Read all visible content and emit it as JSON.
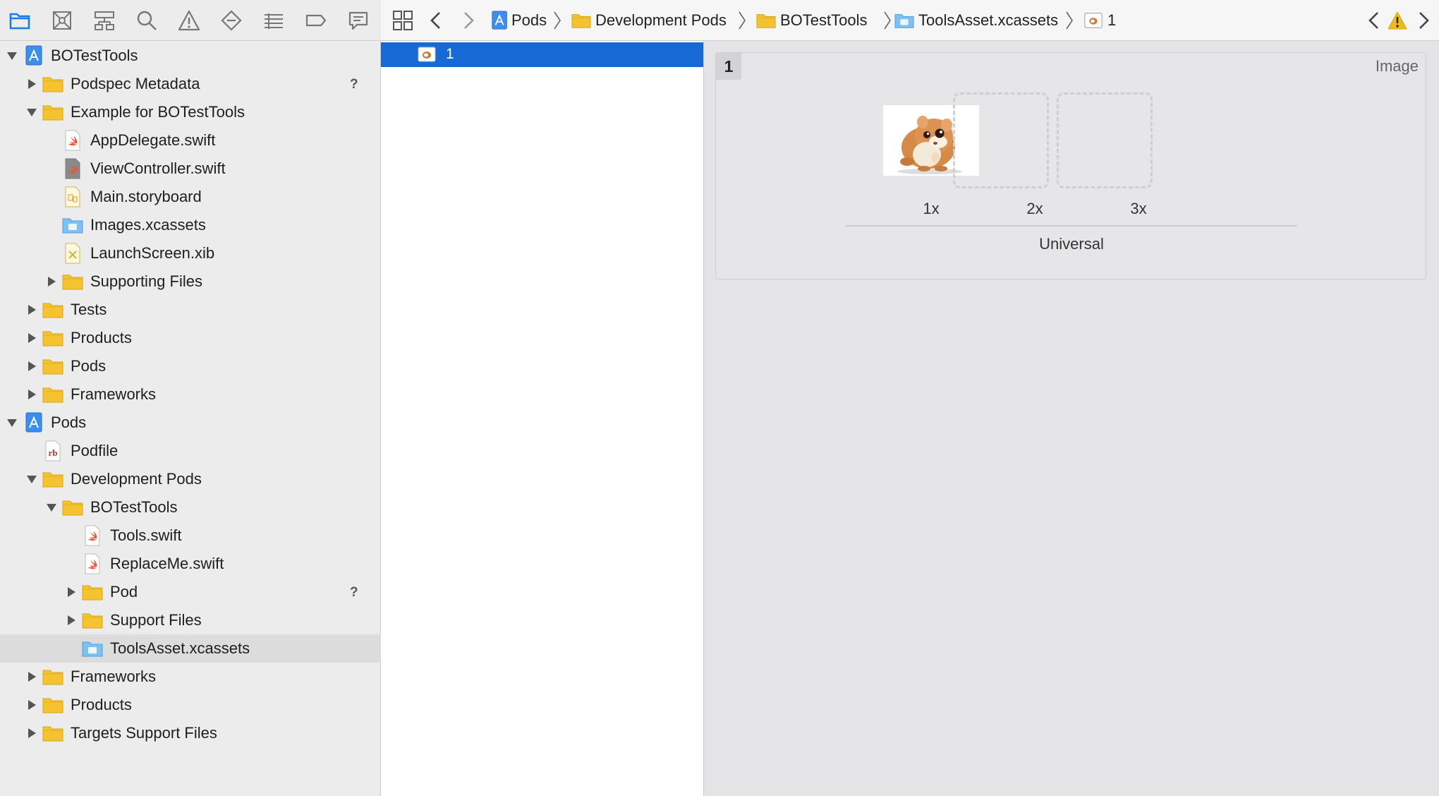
{
  "toolbar": {
    "icons": [
      "folder-icon",
      "source-control-icon",
      "hierarchy-icon",
      "search-icon",
      "warning-icon",
      "test-diamond-icon",
      "debug-list-icon",
      "breakpoint-icon",
      "report-icon"
    ]
  },
  "navigator": {
    "rows": [
      {
        "label": "BOTestTools",
        "icon": "project",
        "disclosure": "open",
        "badge": ""
      },
      {
        "label": "Podspec Metadata",
        "icon": "folder",
        "disclosure": "closed",
        "badge": "?"
      },
      {
        "label": "Example for BOTestTools",
        "icon": "folder",
        "disclosure": "open",
        "badge": ""
      },
      {
        "label": "AppDelegate.swift",
        "icon": "swift",
        "disclosure": "none",
        "badge": ""
      },
      {
        "label": "ViewController.swift",
        "icon": "swift-dark",
        "disclosure": "none",
        "badge": ""
      },
      {
        "label": "Main.storyboard",
        "icon": "storyboard",
        "disclosure": "none",
        "badge": ""
      },
      {
        "label": "Images.xcassets",
        "icon": "xcassets",
        "disclosure": "none",
        "badge": ""
      },
      {
        "label": "LaunchScreen.xib",
        "icon": "xib",
        "disclosure": "none",
        "badge": ""
      },
      {
        "label": "Supporting Files",
        "icon": "folder",
        "disclosure": "closed",
        "badge": ""
      },
      {
        "label": "Tests",
        "icon": "folder",
        "disclosure": "closed",
        "badge": ""
      },
      {
        "label": "Products",
        "icon": "folder",
        "disclosure": "closed",
        "badge": ""
      },
      {
        "label": "Pods",
        "icon": "folder",
        "disclosure": "closed",
        "badge": ""
      },
      {
        "label": "Frameworks",
        "icon": "folder",
        "disclosure": "closed",
        "badge": ""
      },
      {
        "label": "Pods",
        "icon": "project",
        "disclosure": "open",
        "badge": ""
      },
      {
        "label": "Podfile",
        "icon": "ruby",
        "disclosure": "none",
        "badge": ""
      },
      {
        "label": "Development Pods",
        "icon": "folder",
        "disclosure": "open",
        "badge": ""
      },
      {
        "label": "BOTestTools",
        "icon": "folder",
        "disclosure": "open",
        "badge": ""
      },
      {
        "label": "Tools.swift",
        "icon": "swift",
        "disclosure": "none",
        "badge": ""
      },
      {
        "label": "ReplaceMe.swift",
        "icon": "swift",
        "disclosure": "none",
        "badge": ""
      },
      {
        "label": "Pod",
        "icon": "folder",
        "disclosure": "closed",
        "badge": "?"
      },
      {
        "label": "Support Files",
        "icon": "folder",
        "disclosure": "closed",
        "badge": ""
      },
      {
        "label": "ToolsAsset.xcassets",
        "icon": "xcassets",
        "disclosure": "none",
        "badge": "",
        "selected": true
      },
      {
        "label": "Frameworks",
        "icon": "folder",
        "disclosure": "closed",
        "badge": ""
      },
      {
        "label": "Products",
        "icon": "folder",
        "disclosure": "closed",
        "badge": ""
      },
      {
        "label": "Targets Support Files",
        "icon": "folder",
        "disclosure": "closed",
        "badge": ""
      }
    ]
  },
  "jumpbar": {
    "crumbs": [
      {
        "label": "Pods",
        "icon": "project"
      },
      {
        "label": "Development Pods",
        "icon": "folder"
      },
      {
        "label": "BOTestTools",
        "icon": "folder"
      },
      {
        "label": "ToolsAsset.xcassets",
        "icon": "xcassets"
      },
      {
        "label": "1",
        "icon": "imageset"
      }
    ]
  },
  "asset_list": {
    "items": [
      {
        "label": "1",
        "selected": true
      }
    ]
  },
  "detail": {
    "set_name": "1",
    "set_type": "Image",
    "slots": [
      {
        "label": "1x",
        "filled": true
      },
      {
        "label": "2x",
        "filled": false
      },
      {
        "label": "3x",
        "filled": false
      }
    ],
    "group_label": "Universal"
  },
  "colors": {
    "selection": "#1769d6",
    "folder": "#f5c330",
    "accent": "#1a7ae8",
    "warning": "#f2b821"
  }
}
